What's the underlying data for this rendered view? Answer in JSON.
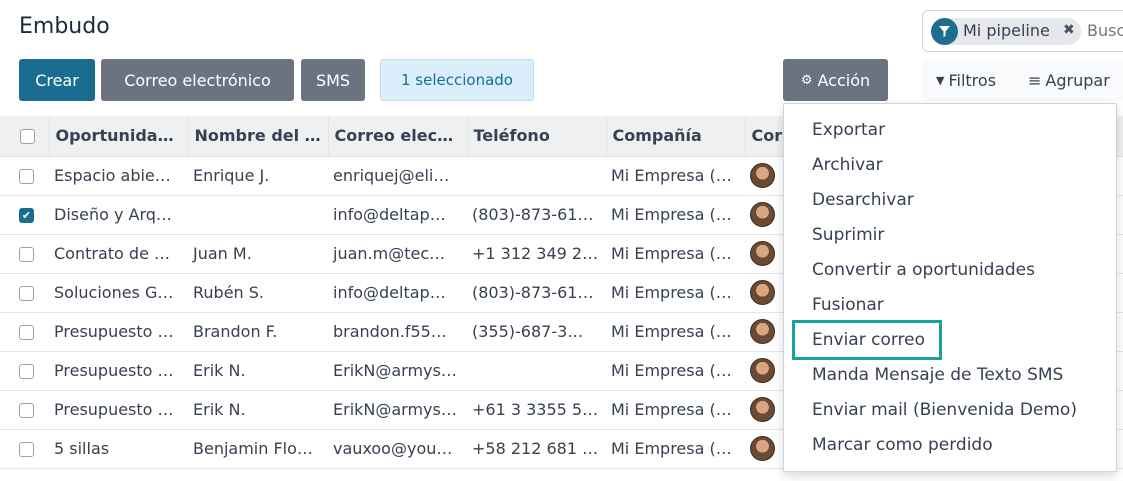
{
  "page": {
    "title": "Embudo"
  },
  "search": {
    "facet_label": "Mi pipeline",
    "facet_icon": "filter-icon",
    "placeholder": "Busc"
  },
  "buttons": {
    "create": "Crear",
    "email": "Correo electrónico",
    "sms": "SMS",
    "selected": "1 seleccionado",
    "action": "Acción",
    "filters": "Filtros",
    "group_by": "Agrupar"
  },
  "columns": [
    "Oportunida…",
    "Nombre del …",
    "Correo elect…",
    "Teléfono",
    "Compañía",
    "Cor"
  ],
  "rows": [
    {
      "checked": false,
      "opportunity": "Espacio abie…",
      "contact": "Enrique J.",
      "email": "enriquej@eli…",
      "phone": "",
      "company": "Mi Empresa (…"
    },
    {
      "checked": true,
      "opportunity": "Diseño y Arq…",
      "contact": "",
      "email": "info@deltap…",
      "phone": "(803)-873-61…",
      "company": "Mi Empresa (…"
    },
    {
      "checked": false,
      "opportunity": "Contrato de …",
      "contact": "Juan M.",
      "email": "juan.m@tec…",
      "phone": "+1 312 349 23…",
      "company": "Mi Empresa (…"
    },
    {
      "checked": false,
      "opportunity": "Soluciones G…",
      "contact": "Rubén S.",
      "email": "info@deltap…",
      "phone": "(803)-873-61…",
      "company": "Mi Empresa (…"
    },
    {
      "checked": false,
      "opportunity": "Presupuesto …",
      "contact": "Brandon F.",
      "email": "brandon.f55…",
      "phone": "(355)-687-3…",
      "company": "Mi Empresa (…"
    },
    {
      "checked": false,
      "opportunity": "Presupuesto …",
      "contact": "Erik N.",
      "email": "ErikN@armys…",
      "phone": "",
      "company": "Mi Empresa (…"
    },
    {
      "checked": false,
      "opportunity": "Presupuesto …",
      "contact": "Erik N.",
      "email": "ErikN@armys…",
      "phone": "+61 3 3355 57…",
      "company": "Mi Empresa (…"
    },
    {
      "checked": false,
      "opportunity": "5 sillas",
      "contact": "Benjamin Flo…",
      "email": "vauxoo@you…",
      "phone": "+58 212 681 0…",
      "company": "Mi Empresa (…"
    }
  ],
  "action_menu": {
    "items": [
      "Exportar",
      "Archivar",
      "Desarchivar",
      "Suprimir",
      "Convertir a oportunidades",
      "Fusionar",
      "Enviar correo",
      "Manda Mensaje de Texto SMS",
      "Enviar mail (Bienvenida Demo)",
      "Marcar como perdido"
    ],
    "highlighted": "Enviar correo"
  },
  "colors": {
    "primary": "#1b6c91",
    "secondary": "#6b7280",
    "highlight": "#17a2a0"
  }
}
